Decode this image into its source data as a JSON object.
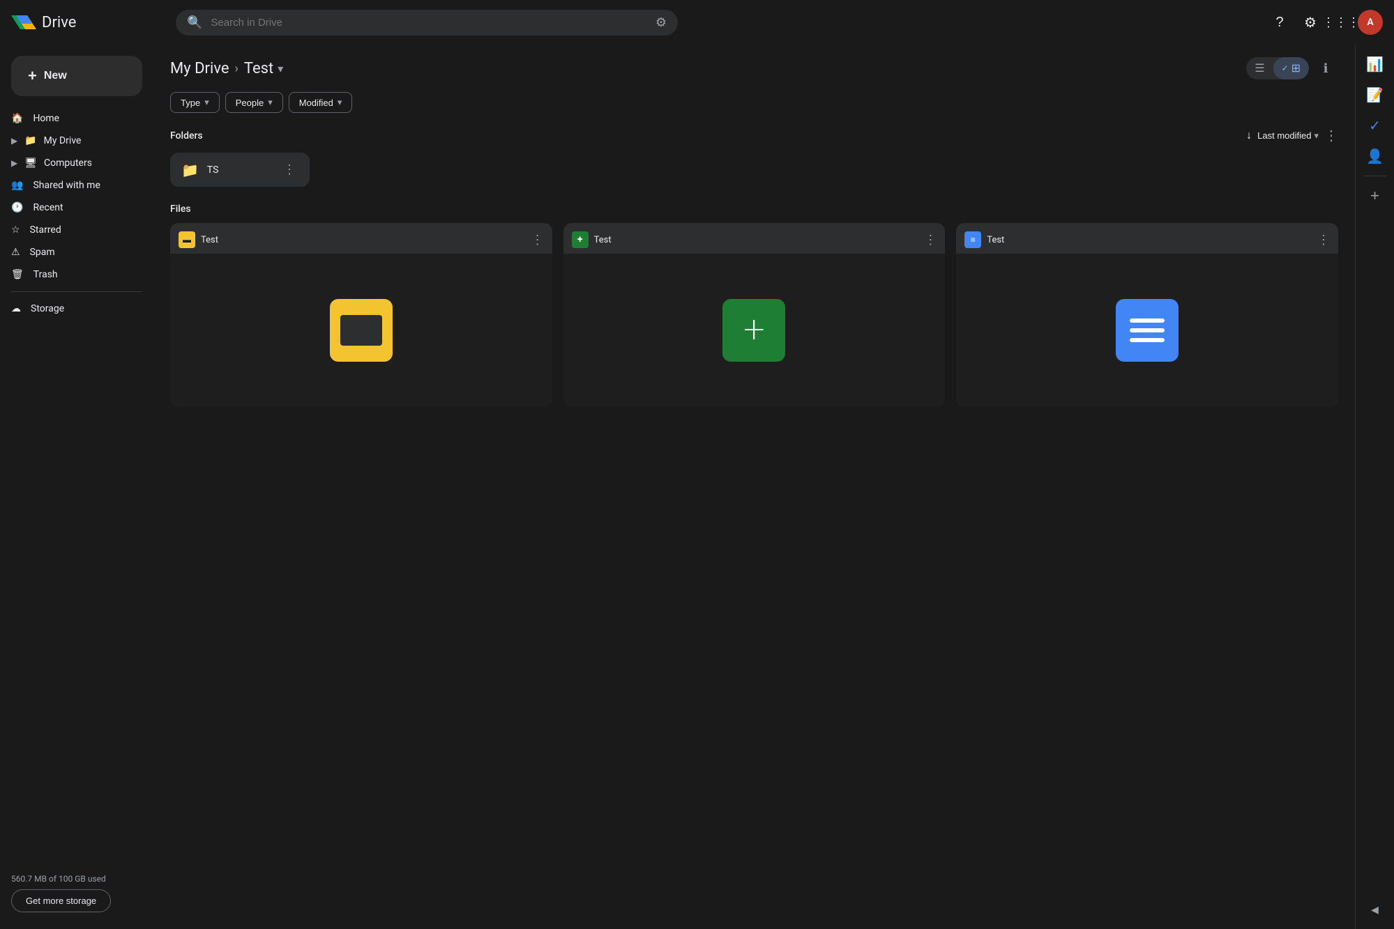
{
  "app": {
    "name": "Drive",
    "logo_alt": "Google Drive"
  },
  "topbar": {
    "search_placeholder": "Search in Drive",
    "help_label": "Help",
    "settings_label": "Settings",
    "apps_label": "Google Apps",
    "avatar_initial": "A"
  },
  "sidebar": {
    "new_button": "New",
    "items": [
      {
        "id": "home",
        "label": "Home",
        "icon": "🏠"
      },
      {
        "id": "my-drive",
        "label": "My Drive",
        "icon": "📁",
        "has_arrow": true
      },
      {
        "id": "computers",
        "label": "Computers",
        "icon": "🖥",
        "has_arrow": true
      },
      {
        "id": "shared-with-me",
        "label": "Shared with me",
        "icon": "👥"
      },
      {
        "id": "recent",
        "label": "Recent",
        "icon": "🕐"
      },
      {
        "id": "starred",
        "label": "Starred",
        "icon": "⭐"
      },
      {
        "id": "spam",
        "label": "Spam",
        "icon": "⚠"
      },
      {
        "id": "trash",
        "label": "Trash",
        "icon": "🗑"
      },
      {
        "id": "storage",
        "label": "Storage",
        "icon": "☁"
      }
    ],
    "storage_text": "560.7 MB of 100 GB used",
    "get_more_storage": "Get more storage"
  },
  "breadcrumb": {
    "parent": "My Drive",
    "current": "Test",
    "arrow_down": "▾"
  },
  "view_controls": {
    "list_label": "List view",
    "grid_label": "Grid view",
    "info_label": "View details"
  },
  "filters": [
    {
      "id": "type",
      "label": "Type"
    },
    {
      "id": "people",
      "label": "People"
    },
    {
      "id": "modified",
      "label": "Modified"
    }
  ],
  "folders_section": {
    "title": "Folders",
    "sort_label": "Last modified",
    "more_label": "More options"
  },
  "folders": [
    {
      "id": "ts",
      "name": "TS"
    }
  ],
  "files_section": {
    "title": "Files"
  },
  "files": [
    {
      "id": "slides-test",
      "name": "Test",
      "type": "slides",
      "type_color": "#f4c430",
      "type_icon": "▬"
    },
    {
      "id": "forms-test",
      "name": "Test",
      "type": "forms",
      "type_color": "#1e7e34",
      "type_icon": "+"
    },
    {
      "id": "docs-test",
      "name": "Test",
      "type": "docs",
      "type_color": "#4285f4",
      "type_icon": "≡"
    }
  ],
  "right_sidebar": {
    "sheets_label": "Google Sheets",
    "keep_label": "Google Keep",
    "tasks_label": "Tasks",
    "meet_label": "Google Meet",
    "add_label": "Add more apps",
    "expand_label": "Expand"
  }
}
